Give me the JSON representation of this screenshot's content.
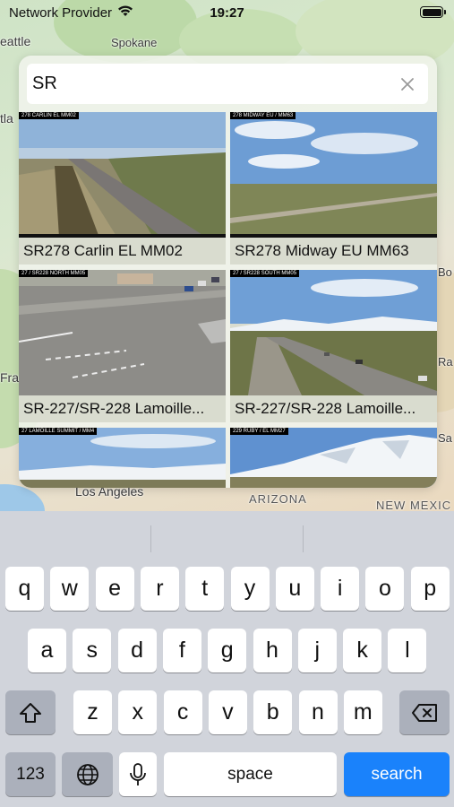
{
  "status_bar": {
    "carrier": "Network Provider",
    "time": "19:27",
    "battery_level": 1.0
  },
  "map": {
    "labels": {
      "seattle": "eattle",
      "spokane": "Spokane",
      "portland": "tla",
      "san_francisco": "Fra",
      "los_angeles": "Los Angeles",
      "arizona": "ARIZONA",
      "new_mexico": "NEW MEXIC",
      "right_edge_1": "Bo",
      "right_edge_2": "Ra",
      "right_edge_3": "Sa"
    }
  },
  "search": {
    "query": "SR",
    "placeholder": ""
  },
  "cameras": [
    {
      "overlay": "278 CARLIN EL MM02",
      "label": "SR278 Carlin EL MM02"
    },
    {
      "overlay": "278 MIDWAY EU / MM63",
      "label": "SR278 Midway EU MM63"
    },
    {
      "overlay": "27 / SR228 NORTH MM05",
      "label": "SR-227/SR-228 Lamoille..."
    },
    {
      "overlay": "27 / SR228 SOUTH MM05",
      "label": "SR-227/SR-228 Lamoille..."
    },
    {
      "overlay": "27 LAMOILLE SUMMIT / MM4",
      "label": ""
    },
    {
      "overlay": "229 RUBY / EL MM27",
      "label": ""
    }
  ],
  "keyboard": {
    "row1": [
      "q",
      "w",
      "e",
      "r",
      "t",
      "y",
      "u",
      "i",
      "o",
      "p"
    ],
    "row2": [
      "a",
      "s",
      "d",
      "f",
      "g",
      "h",
      "j",
      "k",
      "l"
    ],
    "row3": [
      "z",
      "x",
      "c",
      "v",
      "b",
      "n",
      "m"
    ],
    "numbers_key": "123",
    "space_key": "space",
    "search_key": "search"
  },
  "colors": {
    "accent": "#1a82fb",
    "keyboard_bg": "#d1d4db"
  }
}
